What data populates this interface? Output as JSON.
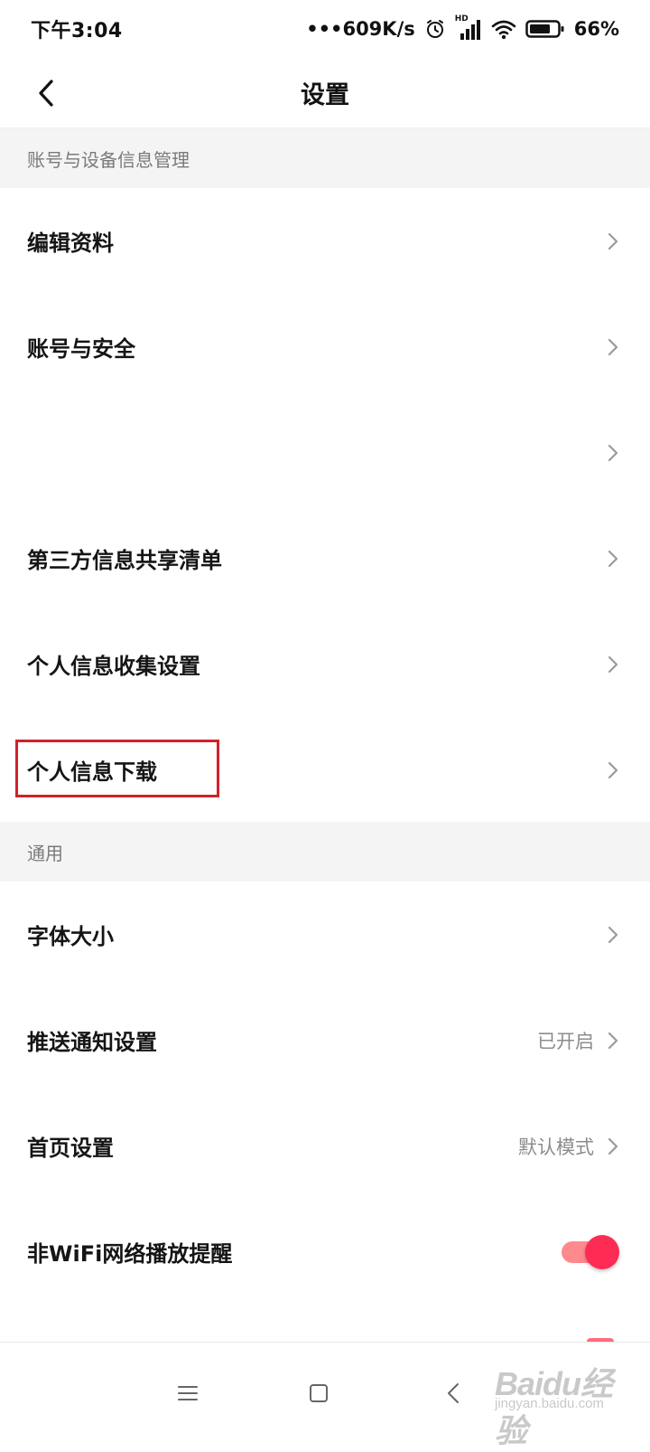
{
  "status": {
    "time": "下午3:04",
    "speed": "•••609K/s",
    "hd": "HD",
    "battery": "66%"
  },
  "header": {
    "title": "设置"
  },
  "sections": [
    {
      "title": "账号与设备信息管理"
    },
    {
      "title": "通用"
    }
  ],
  "rows": [
    {
      "label": "编辑资料",
      "value": ""
    },
    {
      "label": "账号与安全",
      "value": ""
    },
    {
      "label": "",
      "value": ""
    },
    {
      "label": "第三方信息共享清单",
      "value": ""
    },
    {
      "label": "个人信息收集设置",
      "value": ""
    },
    {
      "label": "个人信息下载",
      "value": ""
    },
    {
      "label": "字体大小",
      "value": ""
    },
    {
      "label": "推送通知设置",
      "value": "已开启"
    },
    {
      "label": "首页设置",
      "value": "默认模式"
    },
    {
      "label": "非WiFi网络播放提醒",
      "value": "",
      "toggle_on": true
    }
  ],
  "watermark": {
    "text": "Baidu经验",
    "sub": "jingyan.baidu.com"
  },
  "colors": {
    "accent": "#fe2c55",
    "highlight": "#d0222a",
    "section_bg": "#f4f4f4"
  }
}
